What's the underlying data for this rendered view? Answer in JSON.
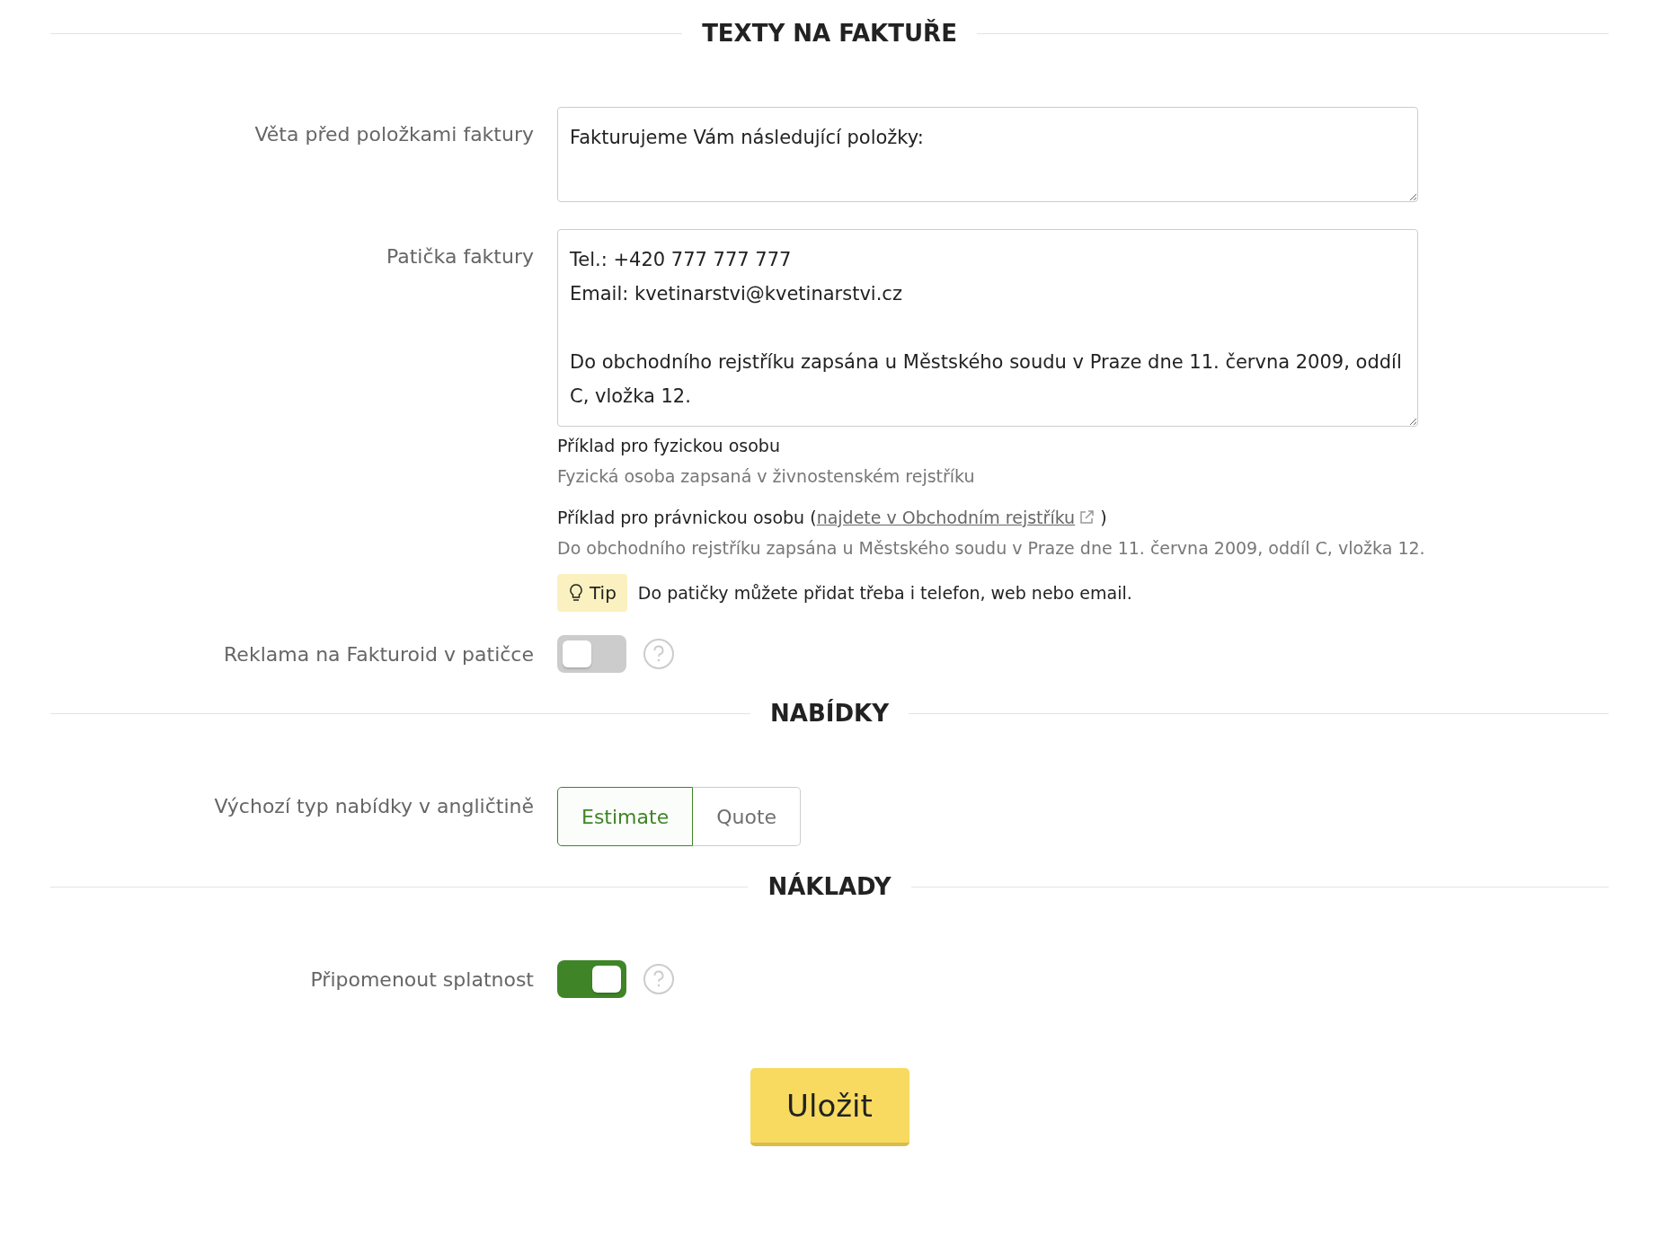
{
  "sections": [
    {
      "title": "TEXTY NA FAKTUŘE",
      "fields": [
        {
          "kind": "textarea",
          "label": "Věta před položkami faktury",
          "value": "Fakturujeme Vám následující položky:"
        },
        {
          "kind": "textarea",
          "label": "Patička faktury",
          "value": "Tel.: +420 777 777 777\nEmail: kvetinarstvi@kvetinarstvi.cz\n\nDo obchodního rejstříku zapsána u Městského soudu v Praze dne 11. června 2009, oddíl C, vložka 12.",
          "notes": [
            {
              "kind": "example",
              "text": "Příklad pro fyzickou osobu",
              "example": "Fyzická osoba zapsaná v živnostenském rejstříku"
            },
            {
              "kind": "example",
              "text": "Příklad pro právnickou osobu (",
              "link": "najdete v Obchodním rejstříku",
              "after": ")",
              "example": "Do obchodního rejstříku zapsána u Městského soudu v Praze dne 11. června 2009, oddíl C, vložka 12."
            },
            {
              "kind": "tip",
              "badge": "Tip",
              "text": "Do patičky můžete přidat třeba i telefon, web nebo email."
            }
          ]
        },
        {
          "kind": "toggle",
          "label": "Reklama na Fakturoid v patičce",
          "on": false
        }
      ]
    },
    {
      "title": "NABÍDKY",
      "fields": [
        {
          "kind": "segmented",
          "label": "Výchozí typ nabídky v angličtině",
          "options": [
            {
              "label": "Estimate",
              "selected": true
            },
            {
              "label": "Quote",
              "selected": false
            }
          ]
        }
      ]
    },
    {
      "title": "NÁKLADY",
      "fields": [
        {
          "kind": "toggle",
          "label": "Připomenout splatnost",
          "on": true
        }
      ]
    }
  ],
  "save_button": "Uložit"
}
